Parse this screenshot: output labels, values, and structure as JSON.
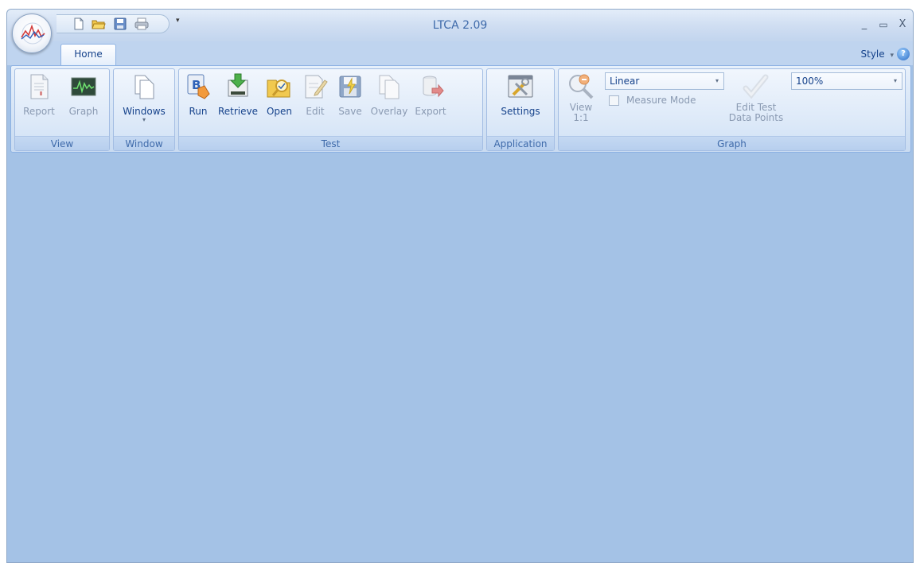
{
  "window": {
    "title": "LTCA 2.09",
    "minimize": "_",
    "maximize": "▭",
    "close": "X"
  },
  "tabs": [
    {
      "label": "Home",
      "active": true
    }
  ],
  "style_menu": {
    "label": "Style",
    "arrow": "▾"
  },
  "help_glyph": "?",
  "ribbon": {
    "groups": {
      "view": {
        "label": "View",
        "buttons": [
          {
            "label": "Report",
            "icon": "report-icon",
            "enabled": false
          },
          {
            "label": "Graph",
            "icon": "graph-icon",
            "enabled": false
          }
        ]
      },
      "window": {
        "label": "Window",
        "buttons": [
          {
            "label": "Windows",
            "icon": "windows-icon",
            "enabled": true,
            "dropdown_glyph": "▾"
          }
        ]
      },
      "test": {
        "label": "Test",
        "buttons": [
          {
            "label": "Run",
            "icon": "run-icon",
            "enabled": true
          },
          {
            "label": "Retrieve",
            "icon": "retrieve-icon",
            "enabled": true
          },
          {
            "label": "Open",
            "icon": "open-icon",
            "enabled": true
          },
          {
            "label": "Edit",
            "icon": "edit-icon",
            "enabled": false
          },
          {
            "label": "Save",
            "icon": "save-icon",
            "enabled": false
          },
          {
            "label": "Overlay",
            "icon": "overlay-icon",
            "enabled": false
          },
          {
            "label": "Export",
            "icon": "export-icon",
            "enabled": false
          }
        ]
      },
      "application": {
        "label": "Application",
        "buttons": [
          {
            "label": "Settings",
            "icon": "settings-icon",
            "enabled": true
          }
        ]
      },
      "graph": {
        "label": "Graph",
        "view_button": {
          "label_line1": "View",
          "label_line2": "1:1",
          "icon": "zoom-out-icon",
          "enabled": false
        },
        "scale_select": {
          "value": "Linear"
        },
        "measure_mode": {
          "label": "Measure Mode",
          "checked": false,
          "enabled": false
        },
        "edit_points_button": {
          "label_line1": "Edit Test",
          "label_line2": "Data Points",
          "icon": "checkmark-icon",
          "enabled": false
        },
        "zoom_select": {
          "value": "100%"
        }
      }
    }
  },
  "colors": {
    "client_background": "#a4c2e6",
    "ribbon_text": "#15428b",
    "disabled_text": "#8a9ab2"
  }
}
